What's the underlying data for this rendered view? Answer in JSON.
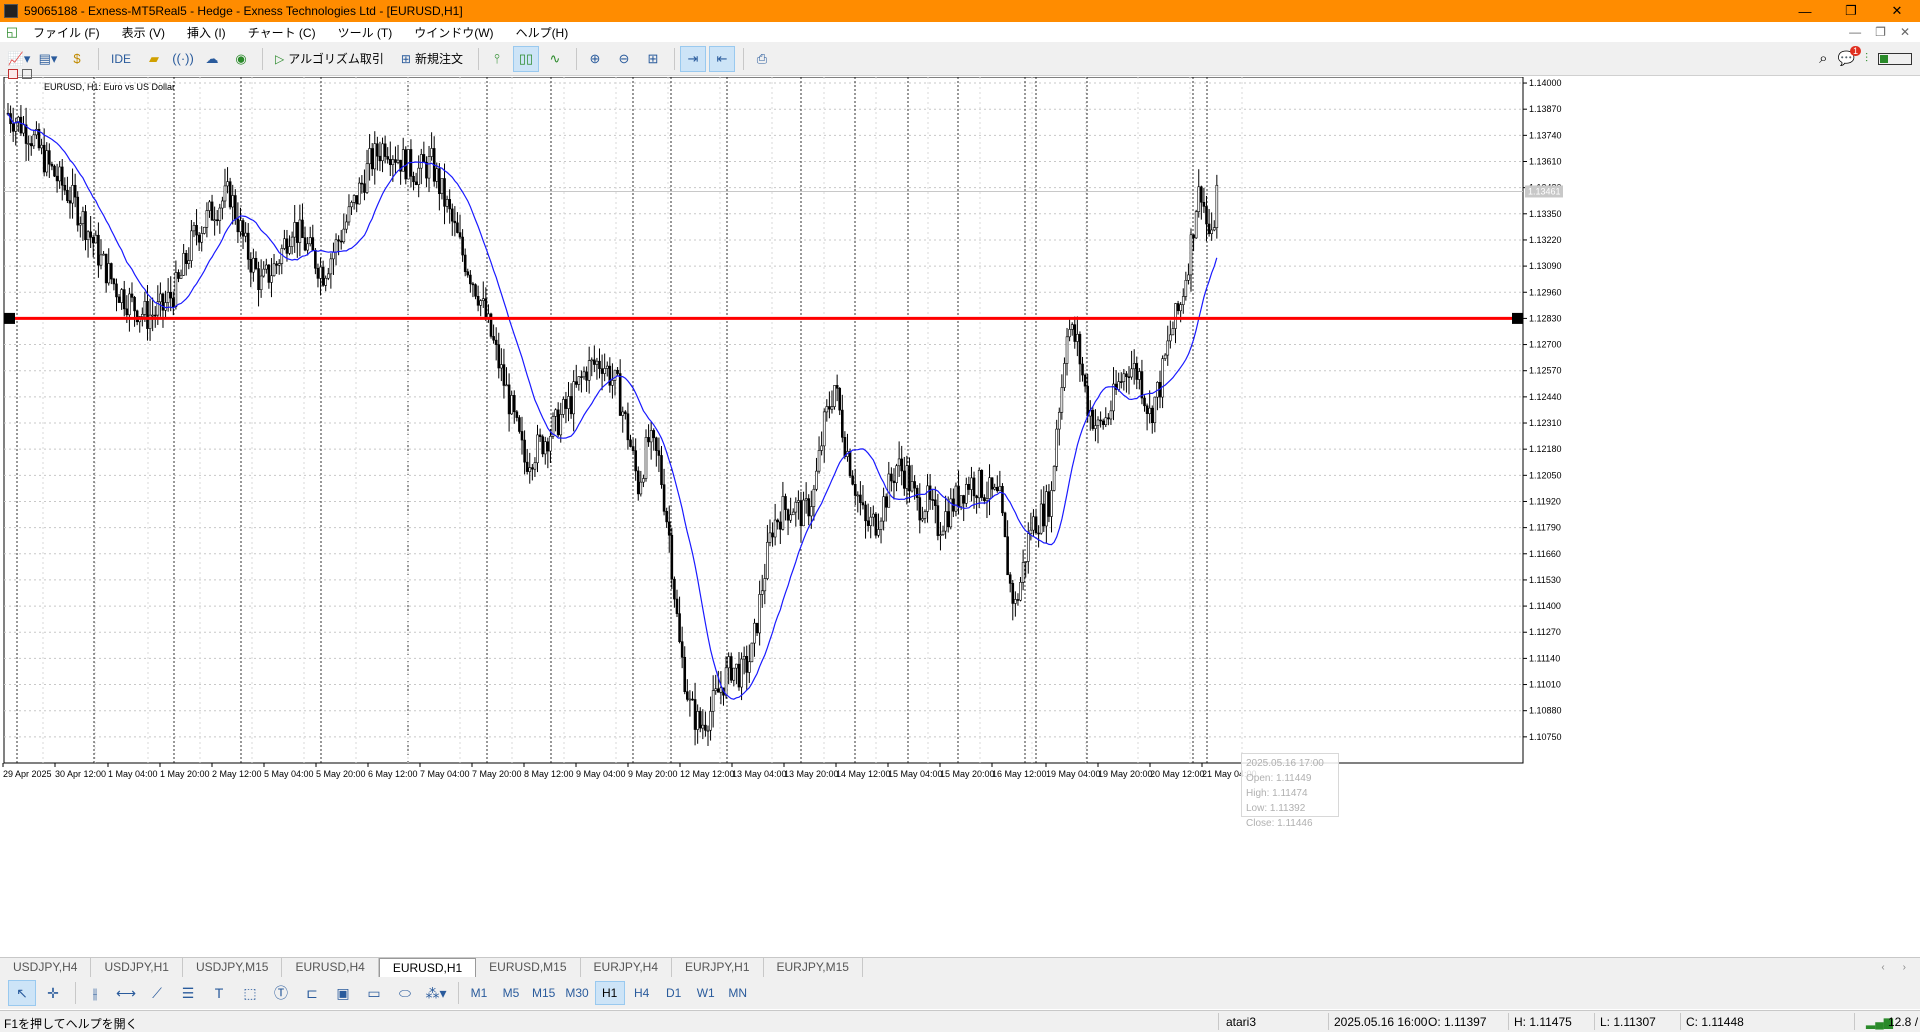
{
  "window": {
    "title": "59065188 - Exness-MT5Real5 - Hedge - Exness Technologies Ltd - [EURUSD,H1]",
    "minimize_glyph": "—",
    "maximize_glyph": "❐",
    "close_glyph": "✕"
  },
  "menu": {
    "items": [
      "ファイル (F)",
      "表示 (V)",
      "挿入 (I)",
      "チャート (C)",
      "ツール (T)",
      "ウインドウ(W)",
      "ヘルプ(H)"
    ],
    "window_controls": [
      "—",
      "❐",
      "✕"
    ]
  },
  "toolbar": {
    "ide_label": "IDE",
    "algo_label": "アルゴリズム取引",
    "new_order_label": "新規注文",
    "notification_count": "1",
    "icons": [
      "chart-type-icon",
      "template-icon",
      "quotes-icon",
      "ide-icon",
      "portfolio-icon",
      "signal-icon",
      "cloud-icon",
      "vps-icon",
      "algo-trading-icon",
      "new-order-icon",
      "bar-chart-icon",
      "candle-chart-icon",
      "line-chart-icon",
      "zoom-in-icon",
      "zoom-out-icon",
      "grid-icon",
      "autoscroll-icon",
      "chart-shift-icon",
      "screenshot-icon",
      "search-icon",
      "notifications-icon",
      "signal-strength-icon"
    ]
  },
  "chart": {
    "symbol_title": "EURUSD, H1:  Euro vs US Dollar",
    "current_price_label": "1.13461",
    "tooltip": {
      "date": "2025.05.16 17:00",
      "open": "Open: 1.11449",
      "high": "High: 1.11474",
      "low": "Low: 1.11392",
      "close": "Close: 1.11446"
    },
    "horizontal_line_price": 1.1283,
    "line_color": "#ff0000",
    "ma_color": "#1a1aff",
    "candle_color": "#000000"
  },
  "chart_data": {
    "type": "candlestick",
    "symbol": "EURUSD",
    "timeframe": "H1",
    "ylim": [
      1.1062,
      1.1403
    ],
    "y_ticks": [
      "1.14000",
      "1.13870",
      "1.13740",
      "1.13610",
      "1.13480",
      "1.13350",
      "1.13220",
      "1.13090",
      "1.12960",
      "1.12830",
      "1.12700",
      "1.12570",
      "1.12440",
      "1.12310",
      "1.12180",
      "1.12050",
      "1.11920",
      "1.11790",
      "1.11660",
      "1.11530",
      "1.11400",
      "1.11270",
      "1.11140",
      "1.11010",
      "1.10880",
      "1.10750"
    ],
    "x_ticks": [
      "29 Apr 2025",
      "30 Apr 12:00",
      "1 May 04:00",
      "1 May 20:00",
      "2 May 12:00",
      "5 May 04:00",
      "5 May 20:00",
      "6 May 12:00",
      "7 May 04:00",
      "7 May 20:00",
      "8 May 12:00",
      "9 May 04:00",
      "9 May 20:00",
      "12 May 12:00",
      "13 May 04:00",
      "13 May 20:00",
      "14 May 12:00",
      "15 May 04:00",
      "15 May 20:00",
      "16 May 12:00",
      "19 May 04:00",
      "19 May 20:00",
      "20 May 12:00",
      "21 May 04:00"
    ],
    "close_path": [
      [
        0,
        1.1385
      ],
      [
        8,
        1.1376
      ],
      [
        16,
        1.1358
      ],
      [
        24,
        1.1344
      ],
      [
        30,
        1.133
      ],
      [
        36,
        1.1312
      ],
      [
        42,
        1.1298
      ],
      [
        48,
        1.129
      ],
      [
        54,
        1.1284
      ],
      [
        60,
        1.1288
      ],
      [
        66,
        1.13
      ],
      [
        72,
        1.1324
      ],
      [
        80,
        1.1338
      ],
      [
        86,
        1.1345
      ],
      [
        92,
        1.1318
      ],
      [
        98,
        1.13
      ],
      [
        104,
        1.131
      ],
      [
        110,
        1.133
      ],
      [
        116,
        1.1318
      ],
      [
        122,
        1.1306
      ],
      [
        128,
        1.1322
      ],
      [
        134,
        1.134
      ],
      [
        140,
        1.136
      ],
      [
        146,
        1.137
      ],
      [
        152,
        1.1362
      ],
      [
        158,
        1.1356
      ],
      [
        164,
        1.136
      ],
      [
        170,
        1.1338
      ],
      [
        176,
        1.1315
      ],
      [
        182,
        1.1296
      ],
      [
        188,
        1.127
      ],
      [
        194,
        1.1242
      ],
      [
        200,
        1.1212
      ],
      [
        206,
        1.122
      ],
      [
        212,
        1.123
      ],
      [
        218,
        1.1242
      ],
      [
        224,
        1.1258
      ],
      [
        230,
        1.1262
      ],
      [
        236,
        1.1248
      ],
      [
        240,
        1.1226
      ],
      [
        244,
        1.12
      ],
      [
        248,
        1.1222
      ],
      [
        252,
        1.1212
      ],
      [
        256,
        1.1175
      ],
      [
        260,
        1.112
      ],
      [
        264,
        1.109
      ],
      [
        268,
        1.108
      ],
      [
        272,
        1.1088
      ],
      [
        276,
        1.11
      ],
      [
        280,
        1.111
      ],
      [
        284,
        1.1106
      ],
      [
        288,
        1.1116
      ],
      [
        292,
        1.115
      ],
      [
        296,
        1.118
      ],
      [
        300,
        1.1188
      ],
      [
        304,
        1.119
      ],
      [
        308,
        1.1185
      ],
      [
        312,
        1.1196
      ],
      [
        316,
        1.123
      ],
      [
        320,
        1.125
      ],
      [
        324,
        1.1222
      ],
      [
        328,
        1.12
      ],
      [
        332,
        1.118
      ],
      [
        336,
        1.1182
      ],
      [
        340,
        1.1195
      ],
      [
        344,
        1.121
      ],
      [
        348,
        1.1205
      ],
      [
        352,
        1.119
      ],
      [
        356,
        1.1192
      ],
      [
        360,
        1.118
      ],
      [
        364,
        1.1187
      ],
      [
        368,
        1.1195
      ],
      [
        372,
        1.1202
      ],
      [
        376,
        1.12
      ],
      [
        380,
        1.1196
      ],
      [
        384,
        1.1192
      ],
      [
        386,
        1.117
      ],
      [
        388,
        1.115
      ],
      [
        390,
        1.114
      ],
      [
        392,
        1.1152
      ],
      [
        396,
        1.118
      ],
      [
        400,
        1.1185
      ],
      [
        404,
        1.1195
      ],
      [
        406,
        1.123
      ],
      [
        408,
        1.125
      ],
      [
        410,
        1.128
      ],
      [
        414,
        1.127
      ],
      [
        418,
        1.124
      ],
      [
        422,
        1.1228
      ],
      [
        426,
        1.1235
      ],
      [
        430,
        1.125
      ],
      [
        434,
        1.126
      ],
      [
        438,
        1.1255
      ],
      [
        442,
        1.1235
      ],
      [
        446,
        1.125
      ],
      [
        450,
        1.1275
      ],
      [
        454,
        1.129
      ],
      [
        458,
        1.132
      ],
      [
        460,
        1.134
      ],
      [
        462,
        1.1348
      ],
      [
        464,
        1.133
      ],
      [
        466,
        1.132
      ],
      [
        468,
        1.1346
      ]
    ],
    "moving_average": "blue line (values not labeled)"
  },
  "tabs": [
    "USDJPY,H4",
    "USDJPY,H1",
    "USDJPY,M15",
    "EURUSD,H4",
    "EURUSD,H1",
    "EURUSD,M15",
    "EURJPY,H4",
    "EURJPY,H1",
    "EURJPY,M15"
  ],
  "active_tab": "EURUSD,H1",
  "timeframes": [
    "M1",
    "M5",
    "M15",
    "M30",
    "H1",
    "H4",
    "D1",
    "W1",
    "MN"
  ],
  "active_timeframe": "H1",
  "status": {
    "help": "F1を押してヘルプを開く",
    "profile": "atari3",
    "datetime": "2025.05.16 16:00",
    "open": "O: 1.11397",
    "high": "H: 1.11475",
    "low": "L: 1.11307",
    "close": "C: 1.11448",
    "ping": "12.8 /"
  }
}
